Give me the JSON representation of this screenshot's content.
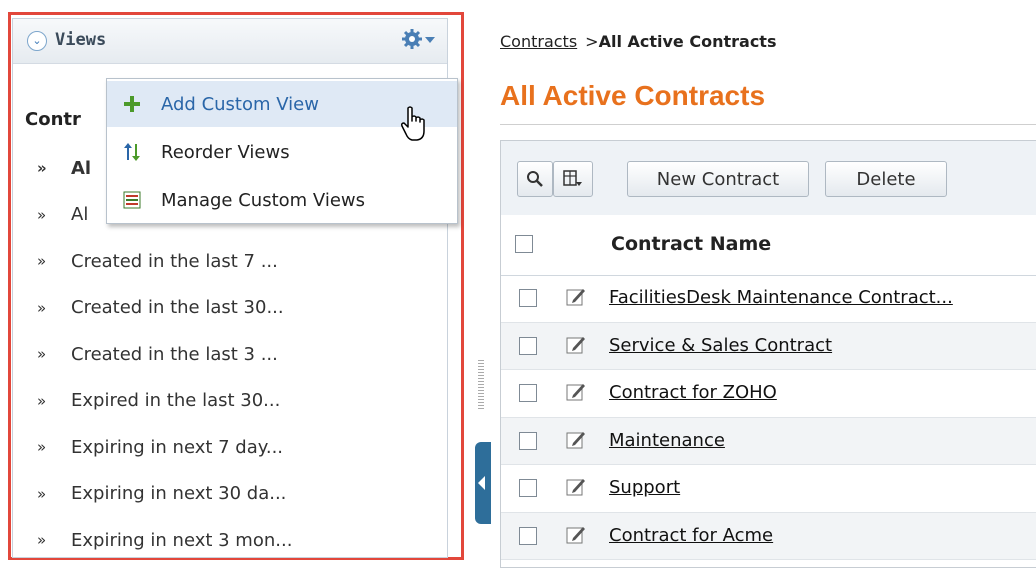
{
  "views_panel": {
    "title": "Views",
    "section_title": "Contr",
    "items": [
      {
        "label": "Al",
        "active": true
      },
      {
        "label": "Al",
        "active": false
      },
      {
        "label": "Created in the last 7 ...",
        "active": false
      },
      {
        "label": "Created in the last 30...",
        "active": false
      },
      {
        "label": "Created in the last 3 ...",
        "active": false
      },
      {
        "label": "Expired in the last 30...",
        "active": false
      },
      {
        "label": "Expiring in next 7 day...",
        "active": false
      },
      {
        "label": "Expiring in next 30 da...",
        "active": false
      },
      {
        "label": "Expiring in next 3 mon...",
        "active": false
      }
    ],
    "menu": [
      {
        "label": "Add Custom View",
        "icon": "plus-icon",
        "hovered": true
      },
      {
        "label": "Reorder Views",
        "icon": "reorder-arrows-icon",
        "hovered": false
      },
      {
        "label": "Manage Custom Views",
        "icon": "list-icon",
        "hovered": false
      }
    ]
  },
  "breadcrumb": {
    "link": "Contracts",
    "separator": ">",
    "current": "All Active Contracts"
  },
  "page_title": "All Active Contracts",
  "toolbar": {
    "new_label": "New Contract",
    "delete_label": "Delete"
  },
  "table": {
    "column_header": "Contract Name",
    "rows": [
      "FacilitiesDesk Maintenance Contract...",
      "Service & Sales Contract",
      "Contract for ZOHO",
      "Maintenance",
      "Support",
      "Contract for Acme"
    ]
  },
  "colors": {
    "accent_orange": "#e8711d",
    "highlight_red": "#e2473b",
    "link_blue": "#2a66a8"
  }
}
